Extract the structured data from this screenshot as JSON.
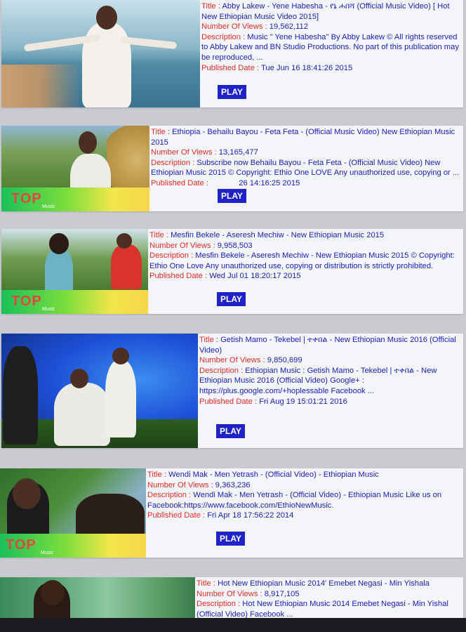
{
  "labels": {
    "title": "Title",
    "views": "Number Of Views",
    "description": "Description",
    "published": "Published Date",
    "play": "PLAY",
    "brand": "TOP",
    "brand_sub": "Music"
  },
  "videos": [
    {
      "title": "Abby Lakew - Yene Habesha - የኔ ሐበሻ (Official Music Video) [ Hot New Ethiopian Music Video 2015]",
      "views": "19,562,112",
      "description": "Music \" Yene Habesha\" By Abby Lakew © All rights reserved to Abby Lakew and BN Studio Productions. No part of this publication may be reproduced, ...",
      "published": "Tue Jun 16 18:41:26 2015"
    },
    {
      "title": "Ethiopia - Behailu Bayou - Feta Feta - (Official Music Video) New Ethiopian Music 2015",
      "views": "13,165,477",
      "description": "Subscribe now Behailu Bayou - Feta Feta - (Official Music Video) New Ethiopian Music 2015 © Copyright: Ethio One LOVE Any unauthorized use, copying or ...",
      "published": "26 14:16:25 2015"
    },
    {
      "title": "Mesfin Bekele - Aseresh Mechiw - New Ethiopian Music 2015",
      "views": "9,958,503",
      "description": "Mesfin Bekele - Aseresh Mechiw - New Ethiopian Music 2015 © Copyright: Ethio One Love Any unauthorized use, copying or distribution is strictly prohibited.",
      "published": "Wed Jul 01 18:20:17 2015"
    },
    {
      "title": "Getish Mamo - Tekebel | ተቀበል - New Ethiopian Music 2016 (Official Video)",
      "views": "9,850,699",
      "description": "Ethiopian Music : Getish Mamo - Tekebel | ተቀበል - New Ethiopian Music 2016 (Official Video) Google+ : https://plus.google.com/+hoplessable Facebook ...",
      "published": "Fri Aug 19 15:01:21 2016"
    },
    {
      "title": "Wendi Mak - Men Yetrash - (Official Video) - Ethiopian Music",
      "views": "9,363,236",
      "description": "Wendi Mak - Men Yetrash - (Official Video) - Ethiopian Music Like us on Facebook:https://www.facebook.com/EthioNewMusic.",
      "published": "Fri Apr 18 17:56:22 2014"
    },
    {
      "title": "Hot New Ethiopian Music 2014' Emebet Negasi - Min Yishala",
      "views": "8,917,105",
      "description": "Hot New Ethiopian Music 2014 Emebet Negasi - Min Yishal (Official Video) Facebook ..."
    }
  ]
}
